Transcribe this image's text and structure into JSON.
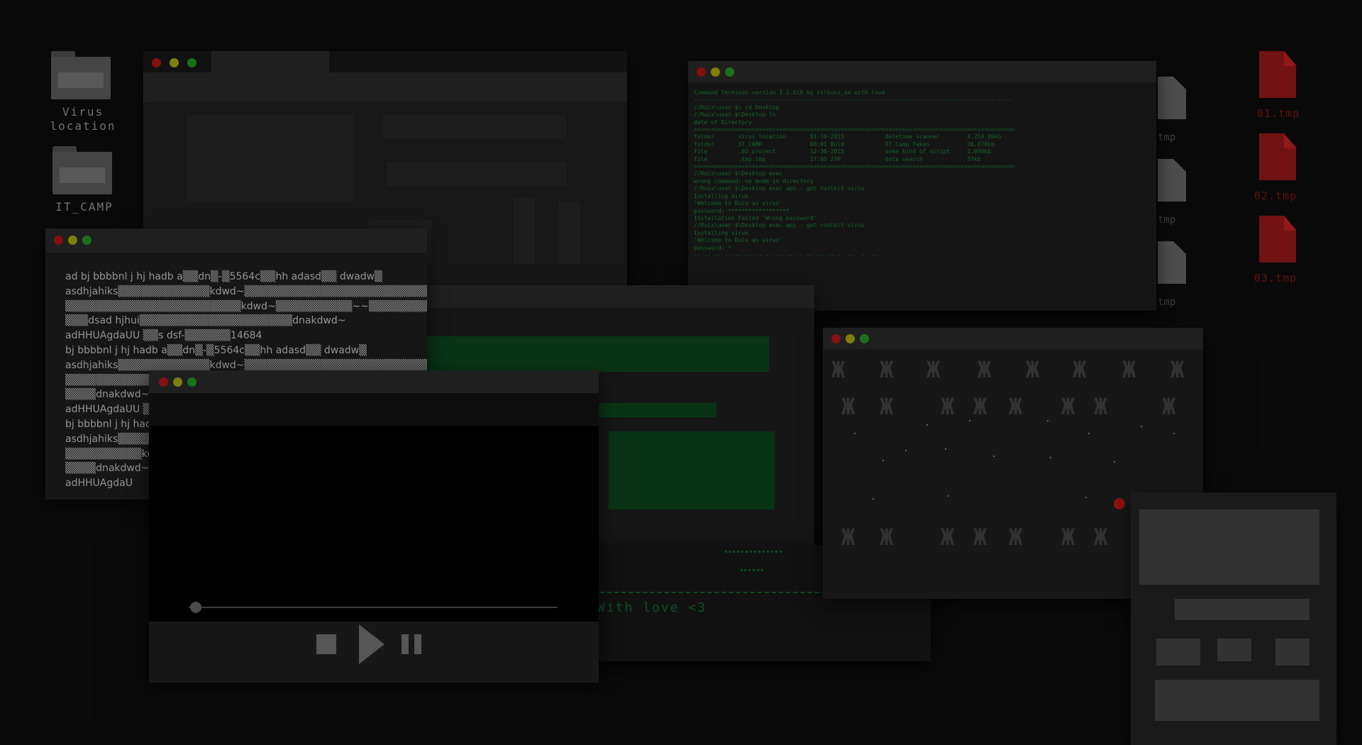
{
  "desktop_icons": [
    {
      "label_line1": "Virus",
      "label_line2": "location"
    },
    {
      "label_line1": "IT_CAMP",
      "label_line2": ""
    }
  ],
  "tmp_files": [
    {
      "label": "01.tmp"
    },
    {
      "label": "02.tmp"
    },
    {
      "label": "03.tmp"
    }
  ],
  "ghost_files": [
    {
      "label": "tmp"
    },
    {
      "label": "tmp"
    },
    {
      "label": "tmp"
    }
  ],
  "text_window": {
    "lines": [
      "ad  bj bbbbnl j hj hadb  a▒▒dn▒-▒5564c▒▒hh adasd▒▒ dwadw▒",
      "asdhjahiks▒▒▒▒▒▒▒▒▒▒▒▒kdwd~▒▒▒▒▒▒▒▒▒▒▒▒▒▒▒▒▒▒▒▒▒▒▒▒▒▒▒▒▒▒▒▒▒▒▒▒▒▒▒▒▒▒▒",
      "▒▒▒▒▒▒▒▒▒▒▒▒▒▒▒▒▒▒▒▒▒▒▒kdwd~▒▒▒▒▒▒▒▒▒▒~~▒▒▒▒▒▒▒▒▒▒▒▒▒▒▒▒▒▒▒▒▒▒▒▒",
      "▒▒▒dsad hjhui▒▒▒▒▒▒▒▒▒▒▒▒▒▒▒▒▒▒▒▒dnakdwd~",
      "adHHUAgdaUU ▒▒s dsf-▒▒▒▒▒▒14684",
      "   bj bbbbnl j hj hadb  a▒▒dn▒-▒5564c▒▒hh adasd▒▒ dwadw▒",
      "asdhjahiks▒▒▒▒▒▒▒▒▒▒▒▒kdwd~▒▒▒▒▒▒▒▒▒▒▒▒▒▒▒▒▒▒▒▒▒▒▒▒▒▒▒▒▒▒▒▒▒▒▒▒▒▒▒▒▒▒▒",
      "▒▒▒▒▒▒▒▒▒▒▒▒▒▒▒▒▒▒▒▒▒▒▒kdwd~▒▒▒▒▒▒▒▒▒▒~~▒▒▒▒▒▒▒▒▒▒▒▒▒▒▒▒▒▒▒▒▒▒▒▒",
      "▒▒▒▒dnakdwd~",
      "adHHUAgdaUU ▒▒s dsf-▒▒▒▒▒▒14684",
      "   bj bbbbnl j hj hadb",
      "asdhjahiks▒▒▒▒▒▒▒▒",
      "▒▒▒▒▒▒▒▒▒▒kdwd~▒",
      "▒▒▒▒dnakdwd~",
      "adHHUAgdaU"
    ]
  },
  "terminal": {
    "lines": [
      "Command Terminal version 1.1.019 by virbuss_so with love",
      "---------------------------------------------------------------------------------------------",
      "//Ruix\\user $\\ cd Desktop",
      "",
      "//Ruix\\user $\\Desktop ls",
      "date of Directory",
      "==============================================================================================",
      "folder       virus location       91-10-2015            datetime scanner        4,254.00kb",
      "folder       IT_CAMP              08:01 Bold            IT Camp Taken           36,870kb",
      "file         .02.project          12-30-2015            some kind of script     2,090kb",
      "file         .tmp.tmp             17:05 2TP             data search             37kb",
      "==============================================================================================",
      "",
      "//Ruix\\user $\\Desktop exec",
      "wrong command: no mode in directory",
      "",
      "//Ruix\\user $\\Desktop exec api - get rootkit virus",
      "Installing virus",
      "'Welcome to Ruix as virus'",
      "password: ******************",
      "Installation Failed 'Wrong password'",
      "",
      "//Ruix\\user $\\Desktop exec api - get rootkit virus",
      "Installing virus",
      "'Welcome to Ruix as virus'",
      "password: *",
      "-- -- -- -- -- -- -- -- -- -- -- -- -- -- -- --  -- --"
    ]
  },
  "footer_text": "With love <3",
  "invaders": {
    "glyph": "Ж"
  },
  "colors": {
    "dot_red": "#a31414",
    "dot_yellow": "#9a9a12",
    "dot_green": "#1f8b1f",
    "terminal_green": "#1c7a34",
    "tmp_red": "#8b1616",
    "bullet_red": "#b01515"
  },
  "video_player": {
    "progress": 0.02
  },
  "icons": {
    "stop": "stop-icon",
    "play": "play-icon",
    "pause": "pause-icon"
  }
}
